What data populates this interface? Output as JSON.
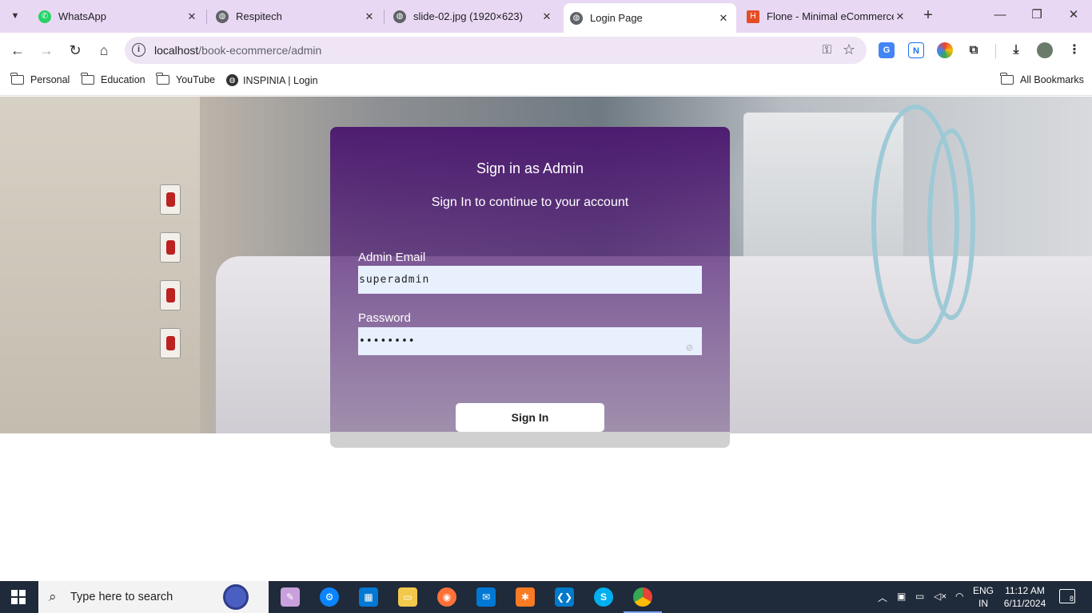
{
  "browser": {
    "tabs": [
      {
        "title": "WhatsApp",
        "icon": "whatsapp-icon",
        "color": "#25d366"
      },
      {
        "title": "Respitech",
        "icon": "globe-icon",
        "color": "#5f6368"
      },
      {
        "title": "slide-02.jpg (1920×623)",
        "icon": "globe-icon",
        "color": "#5f6368"
      },
      {
        "title": "Login Page",
        "icon": "globe-icon",
        "color": "#5f6368",
        "active": true
      },
      {
        "title": "Flone - Minimal eCommerce",
        "icon": "flone-icon",
        "color": "#e44d26"
      }
    ],
    "url_host": "localhost",
    "url_path": "/book-ecommerce/admin",
    "bookmarks": [
      "Personal",
      "Education",
      "YouTube",
      "INSPINIA | Login"
    ],
    "all_bookmarks": "All Bookmarks"
  },
  "login": {
    "title": "Sign in as Admin",
    "subtitle": "Sign In to continue to your account",
    "email_label": "Admin Email",
    "email_value": "superadmin",
    "password_label": "Password",
    "password_value": "••••••••",
    "submit_label": "Sign In"
  },
  "taskbar": {
    "search_placeholder": "Type here to search",
    "lang_top": "ENG",
    "lang_bottom": "IN",
    "time": "11:12 AM",
    "date": "6/11/2024",
    "notification_count": "8"
  },
  "colors": {
    "tab_strip": "#e9d8f3",
    "card_top": "#4a166e",
    "input_bg": "#e8f0fe",
    "taskbar": "#1f2a3a"
  }
}
